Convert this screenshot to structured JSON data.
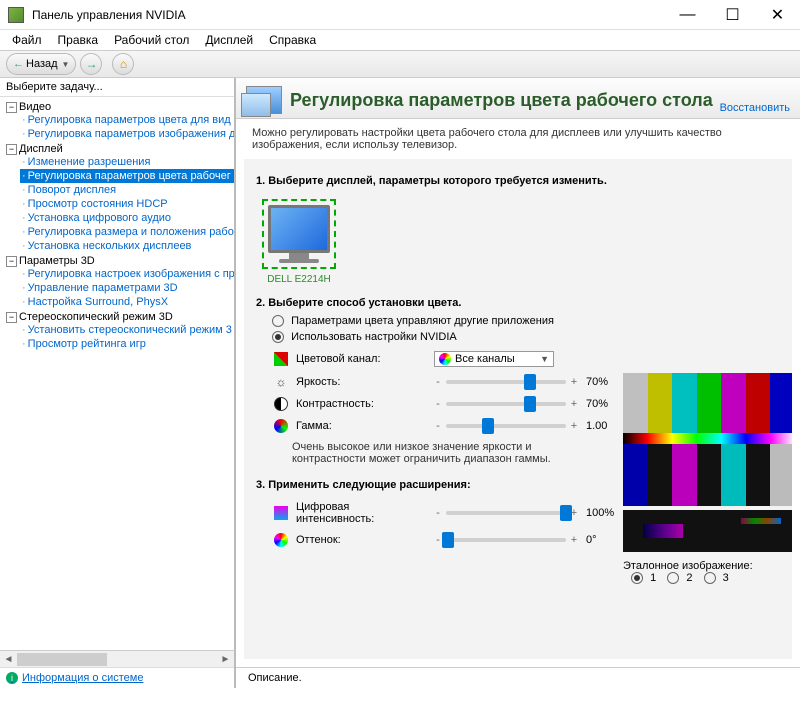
{
  "window": {
    "title": "Панель управления NVIDIA"
  },
  "menubar": [
    "Файл",
    "Правка",
    "Рабочий стол",
    "Дисплей",
    "Справка"
  ],
  "toolbar": {
    "back_label": "Назад"
  },
  "sidebar": {
    "header": "Выберите задачу...",
    "footer_link": "Информация о системе",
    "groups": [
      {
        "label": "Видео",
        "items": [
          "Регулировка параметров цвета для вид",
          "Регулировка параметров изображения д"
        ]
      },
      {
        "label": "Дисплей",
        "items": [
          "Изменение разрешения",
          "Регулировка параметров цвета рабочег",
          "Поворот дисплея",
          "Просмотр состояния HDCP",
          "Установка цифрового аудио",
          "Регулировка размера и положения рабо",
          "Установка нескольких дисплеев"
        ],
        "selected_index": 1
      },
      {
        "label": "Параметры 3D",
        "items": [
          "Регулировка настроек изображения с пр",
          "Управление параметрами 3D",
          "Настройка Surround, PhysX"
        ]
      },
      {
        "label": "Стереоскопический режим 3D",
        "items": [
          "Установить стереоскопический режим 3",
          "Просмотр рейтинга игр"
        ]
      }
    ]
  },
  "main": {
    "title": "Регулировка параметров цвета рабочего стола",
    "restore": "Восстановить",
    "desc": "Можно регулировать настройки цвета рабочего стола для дисплеев или улучшить качество изображения, если использу телевизор.",
    "step1": "1. Выберите дисплей, параметры которого требуется изменить.",
    "monitor_name": "DELL E2214H",
    "step2": "2. Выберите способ установки цвета.",
    "radio1": "Параметрами цвета управляют другие приложения",
    "radio2": "Использовать настройки NVIDIA",
    "channel_label": "Цветовой канал:",
    "channel_value": "Все каналы",
    "brightness_label": "Яркость:",
    "brightness_value": "70%",
    "contrast_label": "Контрастность:",
    "contrast_value": "70%",
    "gamma_label": "Гамма:",
    "gamma_value": "1.00",
    "hint": "Очень высокое или низкое значение яркости и контрастности может ограничить диапазон гаммы.",
    "step3": "3. Применить следующие расширения:",
    "digital_label": "Цифровая интенсивность:",
    "digital_value": "100%",
    "hue_label": "Оттенок:",
    "hue_value": "0°",
    "ref_label": "Эталонное изображение:",
    "ref_options": [
      "1",
      "2",
      "3"
    ],
    "description_label": "Описание."
  }
}
